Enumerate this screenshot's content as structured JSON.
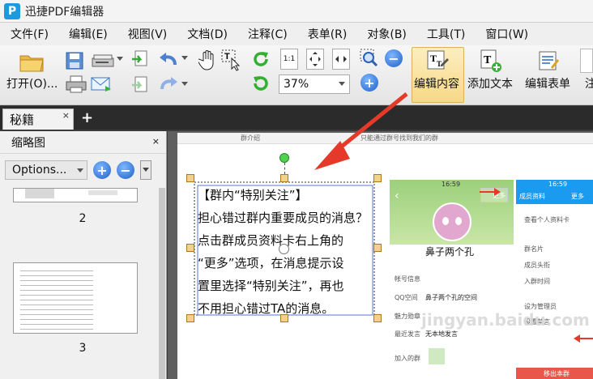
{
  "app": {
    "title": "迅捷PDF编辑器",
    "logo": "P"
  },
  "menu": [
    "文件(F)",
    "编辑(E)",
    "视图(V)",
    "文档(D)",
    "注释(C)",
    "表单(R)",
    "对象(B)",
    "工具(T)",
    "窗口(W)"
  ],
  "toolbar": {
    "open_label": "打开(O)...",
    "zoom_value": "37%",
    "edit_content_label": "编辑内容",
    "add_text_label": "添加文本",
    "edit_form_label": "编辑表单",
    "cut_label": "注"
  },
  "tab": {
    "name": "秘籍",
    "close": "×",
    "add": "+"
  },
  "sidebar": {
    "title": "缩略图",
    "close": "×",
    "options_label": "Options...",
    "page_labels": [
      "2",
      "3"
    ]
  },
  "document": {
    "lines": [
      "【群内“特别关注”】",
      "担心错过群内重要成员的消息？",
      "点击群成员资料卡右上角的",
      "“更多”选项，在消息提示设",
      "置里选择“特别关注”，再也",
      "不用担心错过TA的消息。"
    ],
    "phone1": {
      "status": "16:59",
      "more": "更多",
      "name": "鼻子两个孔",
      "rows": [
        "帐号信息",
        "QQ空间",
        "魅力勋章",
        "最近发言",
        "加入的群"
      ],
      "qq_space_value": "鼻子两个孔的空间",
      "recent_value": "无本地发言"
    },
    "phone2": {
      "status": "16:59",
      "back": "成员资料",
      "more": "更多",
      "rows": [
        "查看个人资料卡",
        "群名片",
        "成员头衔",
        "入群时间",
        "设为管理员",
        "设置禁言"
      ],
      "footer": "移出本群"
    },
    "watermark": "jingyan.baidu.com",
    "top_clip_left": "群介绍",
    "top_clip_mid": "只能通过群号找到我们的群"
  },
  "colors": {
    "accent": "#f6d986",
    "arrow": "#e53a2a",
    "handle": "#f5d08a",
    "rotate": "#3fbf3f"
  }
}
